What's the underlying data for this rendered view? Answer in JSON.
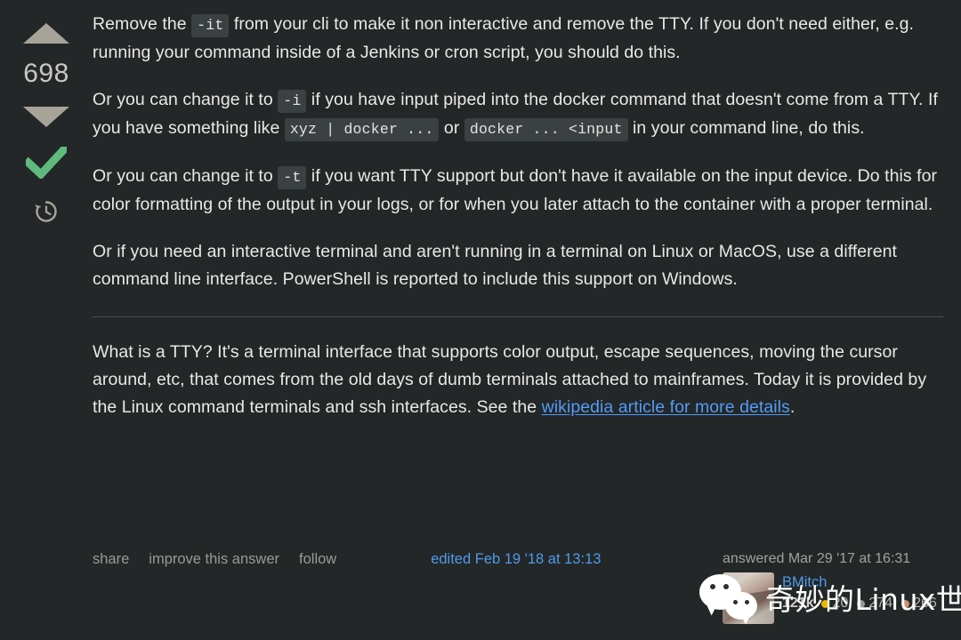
{
  "vote": {
    "count": "698",
    "up_icon": "upvote-arrow-icon",
    "down_icon": "downvote-arrow-icon",
    "accepted_icon": "accepted-answer-checkmark-icon",
    "history_icon": "post-history-clock-icon",
    "arrow_color": "#a8a398",
    "accepted_color": "#5eba7d"
  },
  "body": {
    "p1_a": "Remove the ",
    "p1_code": "-it",
    "p1_b": " from your cli to make it non interactive and remove the TTY. If you don't need either, e.g. running your command inside of a Jenkins or cron script, you should do this.",
    "p2_a": "Or you can change it to ",
    "p2_code": "-i",
    "p2_b": " if you have input piped into the docker command that doesn't come from a TTY. If you have something like ",
    "p2_code2": "xyz | docker ...",
    "p2_c": " or ",
    "p2_code3": "docker ... <input",
    "p2_d": " in your command line, do this.",
    "p3_a": "Or you can change it to ",
    "p3_code": "-t",
    "p3_b": " if you want TTY support but don't have it available on the input device. Do this for color formatting of the output in your logs, or for when you later attach to the container with a proper terminal.",
    "p4": "Or if you need an interactive terminal and aren't running in a terminal on Linux or MacOS, use a different command line interface. PowerShell is reported to include this support on Windows.",
    "p5_a": "What is a TTY? It's a terminal interface that supports color output, escape sequences, moving the cursor around, etc, that comes from the old days of dumb terminals attached to mainframes. Today it is provided by the Linux command terminals and ssh interfaces. See the ",
    "p5_link": "wikipedia article for more details",
    "p5_b": "."
  },
  "footer": {
    "share": "share",
    "improve": "improve this answer",
    "follow": "follow",
    "edited": "edited Feb 19 '18 at 13:13",
    "answered": "answered Mar 29 '17 at 16:31",
    "link_color": "#4f9ae8"
  },
  "user": {
    "name": "BMitch",
    "reputation": "121k",
    "gold": "20",
    "silver": "274",
    "bronze": "266",
    "gold_color": "#f1b600",
    "silver_color": "#9a9b9c",
    "bronze_color": "#cb9170",
    "avatar_icon": "user-avatar-photo"
  },
  "watermark": {
    "text": "奇妙的Linux世界",
    "logo_icon": "wechat-logo-icon"
  }
}
